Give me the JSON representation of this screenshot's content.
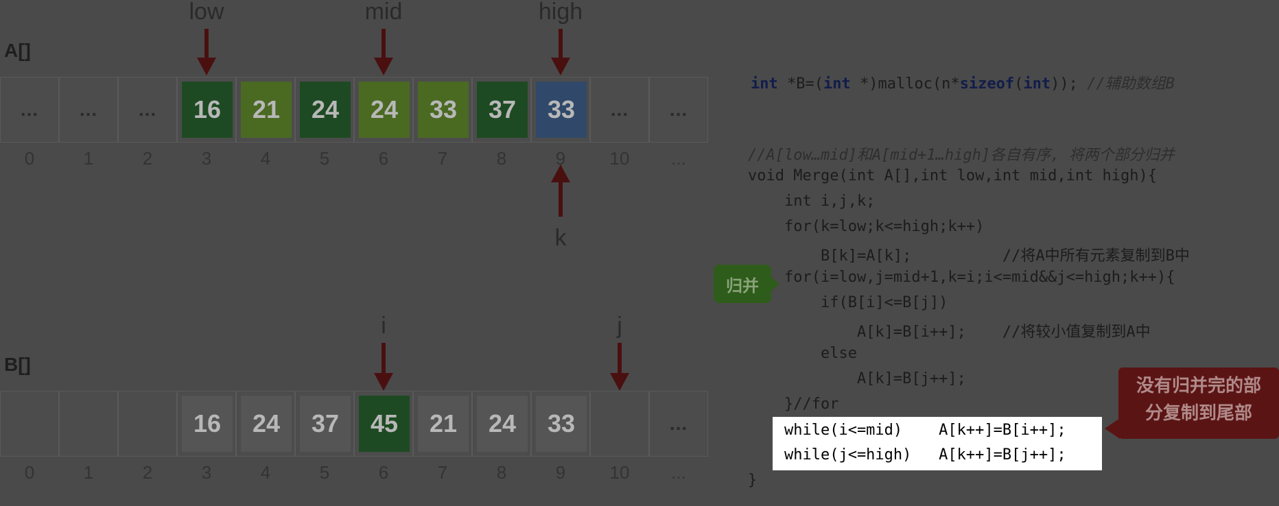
{
  "array_a": {
    "name": "A[]",
    "cells": [
      "...",
      "...",
      "...",
      "16",
      "21",
      "24",
      "24",
      "33",
      "37",
      "33",
      "...",
      "..."
    ],
    "indices": [
      "0",
      "1",
      "2",
      "3",
      "4",
      "5",
      "6",
      "7",
      "8",
      "9",
      "10",
      "..."
    ],
    "cell_colors": [
      "",
      "",
      "",
      "#1d4a22",
      "#4a6a22",
      "#1d4a22",
      "#4a6a22",
      "#4a6a22",
      "#1d4a22",
      "#30496a",
      "",
      ""
    ],
    "pointers_top": [
      {
        "label": "low",
        "index": 3
      },
      {
        "label": "mid",
        "index": 6
      },
      {
        "label": "high",
        "index": 9
      }
    ],
    "pointer_bottom": {
      "label": "k",
      "index": 9
    }
  },
  "array_b": {
    "name": "B[]",
    "cells": [
      "",
      "",
      "",
      "16",
      "24",
      "37",
      "45",
      "21",
      "24",
      "33",
      "",
      "..."
    ],
    "indices": [
      "0",
      "1",
      "2",
      "3",
      "4",
      "5",
      "6",
      "7",
      "8",
      "9",
      "10",
      "..."
    ],
    "cell_colors": [
      "",
      "",
      "",
      "#555555",
      "#555555",
      "#555555",
      "#1d4a22",
      "#555555",
      "#555555",
      "#555555",
      "",
      ""
    ],
    "pointers_top": [
      {
        "label": "i",
        "index": 6
      },
      {
        "label": "j",
        "index": 10
      }
    ]
  },
  "code": {
    "line_malloc": "int *B=(int *)malloc(n*sizeof(int)); //辅助数组B",
    "line_comment": "//A[low…mid]和A[mid+1…high]各自有序, 将两个部分归并",
    "line_func": "void Merge(int A[],int low,int mid,int high){",
    "line_decl": "    int i,j,k;",
    "line_for1": "    for(k=low;k<=high;k++)",
    "line_copy": "        B[k]=A[k];          //将A中所有元素复制到B中",
    "line_for2": "    for(i=low,j=mid+1,k=i;i<=mid&&j<=high;k++){",
    "line_if": "        if(B[i]<=B[j])",
    "line_a1": "            A[k]=B[i++];    //将较小值复制到A中",
    "line_else": "        else",
    "line_a2": "            A[k]=B[j++];",
    "line_endfor": "    }//for",
    "line_while1": "    while(i<=mid)    A[k++]=B[i++];",
    "line_while2": "    while(j<=high)   A[k++]=B[j++];",
    "line_close": "}"
  },
  "badges": {
    "merge": "归并",
    "remainder_line1": "没有归并完的部",
    "remainder_line2": "分复制到尾部"
  },
  "colors": {
    "arrow": "#4a1010",
    "green_dark": "#1d4a22",
    "green_light": "#4a6a22",
    "blue": "#30496a",
    "highlight": "#ffffff"
  }
}
